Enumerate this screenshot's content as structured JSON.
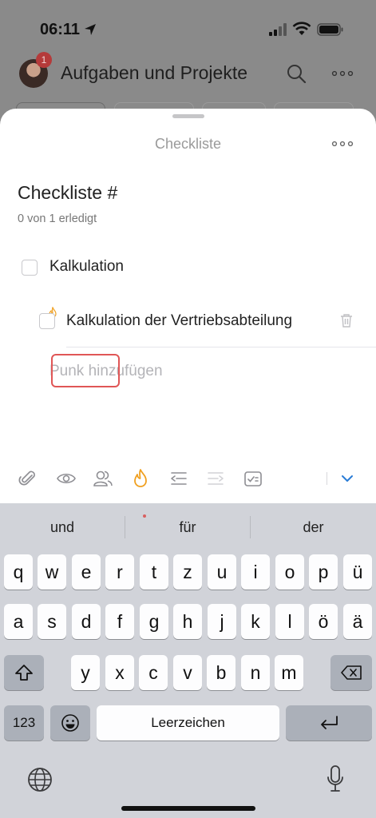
{
  "status_bar": {
    "time": "06:11"
  },
  "app": {
    "title": "Aufgaben und Projekte",
    "notification_count": "1"
  },
  "sheet": {
    "title": "Checkliste",
    "checklist_name": "Checkliste #",
    "progress": "0 von 1 erledigt",
    "items": [
      {
        "label": "Kalkulation",
        "level": 0,
        "checked": false
      },
      {
        "label": "Kalkulation der Vertriebsabteilung",
        "level": 1,
        "checked": false
      }
    ],
    "add_placeholder": "Punk hinzufügen"
  },
  "toolbar": {
    "icons": [
      "paperclip-icon",
      "eye-icon",
      "people-icon",
      "flame-icon",
      "outdent-icon",
      "indent-icon",
      "checklist-icon",
      "chevron-down-icon"
    ],
    "accent_color": "#f0a020",
    "highlight_color": "#e05656",
    "chevron_color": "#2a7cd6"
  },
  "keyboard": {
    "suggestions": [
      "und",
      "für",
      "der"
    ],
    "row1": [
      "q",
      "w",
      "e",
      "r",
      "t",
      "z",
      "u",
      "i",
      "o",
      "p",
      "ü"
    ],
    "row2": [
      "a",
      "s",
      "d",
      "f",
      "g",
      "h",
      "j",
      "k",
      "l",
      "ö",
      "ä"
    ],
    "row3": [
      "y",
      "x",
      "c",
      "v",
      "b",
      "n",
      "m"
    ],
    "numbers_key": "123",
    "space_key": "Leerzeichen"
  }
}
